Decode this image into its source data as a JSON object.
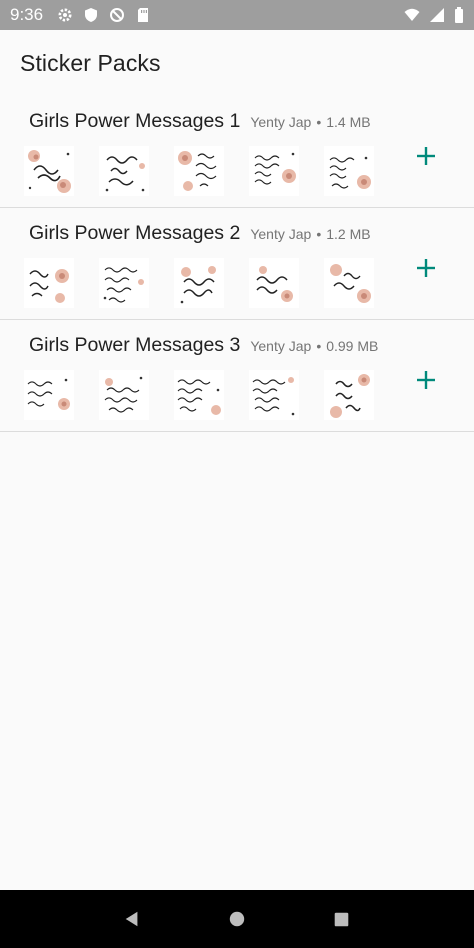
{
  "status_bar": {
    "time": "9:36",
    "left_icons": [
      "gear-icon",
      "shield-icon",
      "no-data-icon",
      "sd-card-icon"
    ],
    "right_icons": [
      "wifi-icon",
      "signal-icon",
      "battery-icon"
    ]
  },
  "app_bar": {
    "title": "Sticker Packs"
  },
  "packs": [
    {
      "name": "Girls Power Messages 1",
      "author": "Yenty Jap",
      "separator": "•",
      "size": "1.4 MB",
      "add_icon": "plus-icon"
    },
    {
      "name": "Girls Power Messages 2",
      "author": "Yenty Jap",
      "separator": "•",
      "size": "1.2 MB",
      "add_icon": "plus-icon"
    },
    {
      "name": "Girls Power Messages 3",
      "author": "Yenty Jap",
      "separator": "•",
      "size": "0.99 MB",
      "add_icon": "plus-icon"
    }
  ],
  "nav_bar": {
    "icons": [
      "back-icon",
      "home-icon",
      "recents-icon"
    ]
  },
  "colors": {
    "accent": "#00897b",
    "status_bar": "#9e9e9e",
    "divider": "#dcdcdc"
  }
}
